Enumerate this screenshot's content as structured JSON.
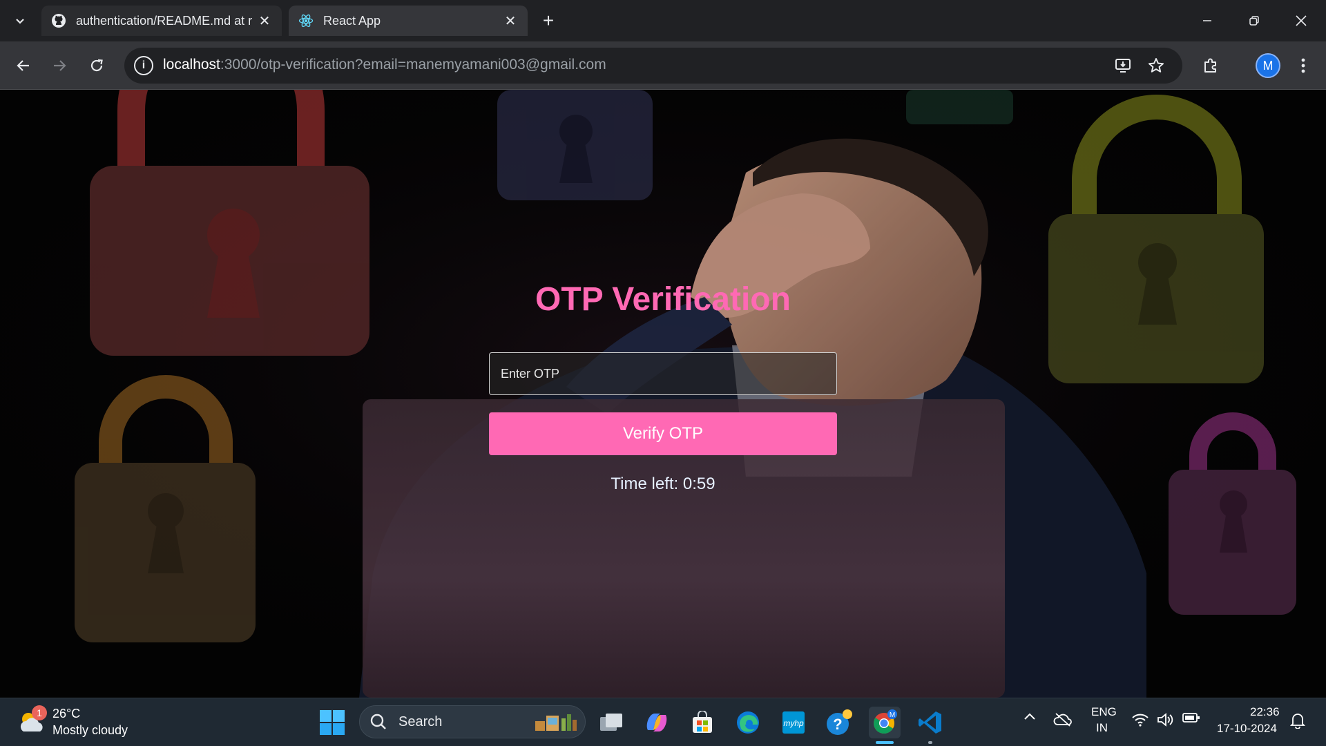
{
  "browser": {
    "tabs": [
      {
        "label": "authentication/README.md at r",
        "favicon": "github-icon",
        "active": false
      },
      {
        "label": "React App",
        "favicon": "react-icon",
        "active": true
      }
    ],
    "new_tab_icon": "plus-icon",
    "url_host": "localhost",
    "url_rest": ":3000/otp-verification?email=manemyamani003@gmail.com",
    "profile_initial": "M"
  },
  "page": {
    "title": "OTP Verification",
    "otp_placeholder": "Enter OTP",
    "otp_value": "",
    "verify_label": "Verify OTP",
    "timer_text": "Time left: 0:59",
    "accent_color": "#ff69b4"
  },
  "taskbar": {
    "weather_badge": "1",
    "weather_temp": "26°C",
    "weather_desc": "Mostly cloudy",
    "search_label": "Search",
    "language_line1": "ENG",
    "language_line2": "IN",
    "time": "22:36",
    "date": "17-10-2024",
    "apps": [
      "start-icon",
      "file-explorer-icon",
      "copilot-icon",
      "microsoft-store-icon",
      "edge-icon",
      "myhp-icon",
      "get-help-icon",
      "chrome-icon",
      "vscode-icon"
    ]
  }
}
